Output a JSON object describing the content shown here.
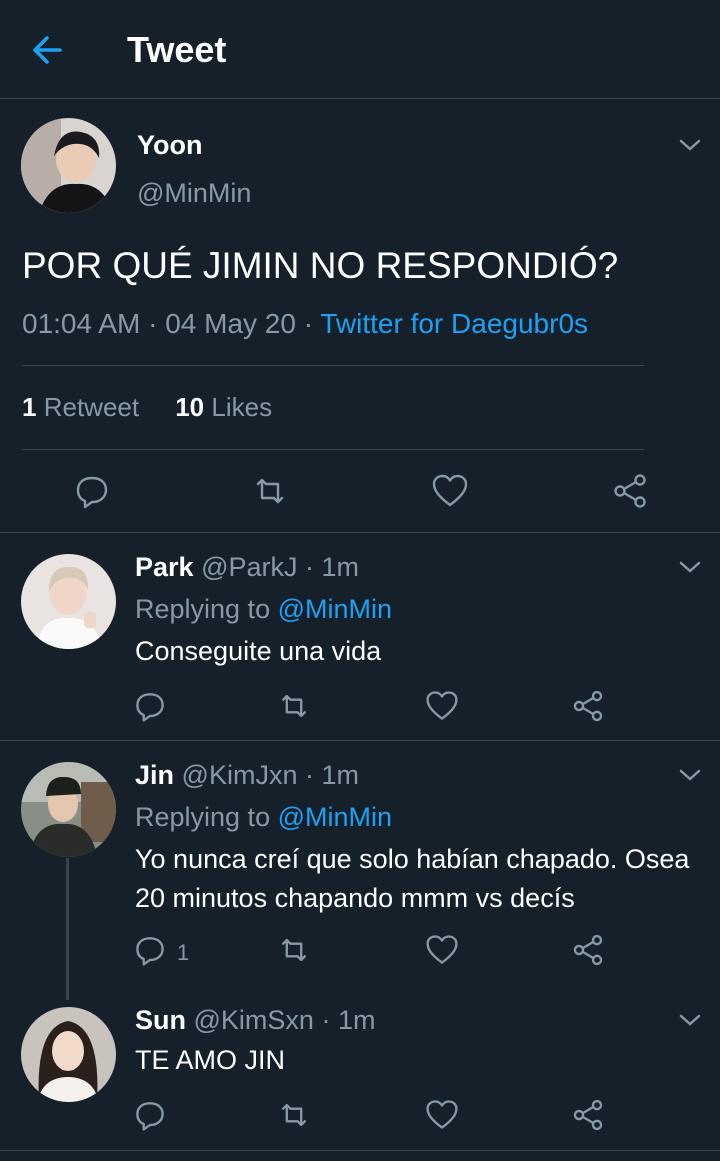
{
  "header": {
    "title": "Tweet"
  },
  "tweet": {
    "name": "Yoon",
    "handle": "@MinMin",
    "text": "POR QUÉ JIMIN NO RESPONDIÓ?",
    "time": "01:04 AM",
    "date": "04 May 20",
    "dot": "·",
    "source": "Twitter for Daegubr0s",
    "retweets": "1",
    "retweets_label": "Retweet",
    "likes": "10",
    "likes_label": "Likes"
  },
  "replies": [
    {
      "name": "Park",
      "handle": "@ParkJ",
      "age": "· 1m",
      "replying_prefix": "Replying to",
      "replying_to": "@MinMin",
      "text": "Conseguite una vida",
      "reply_count": ""
    },
    {
      "name": "Jin",
      "handle": "@KimJxn",
      "age": "· 1m",
      "replying_prefix": "Replying to",
      "replying_to": "@MinMin",
      "text": "Yo nunca creí que solo habían chapado. Osea 20 minutos chapando mmm vs decís",
      "reply_count": "1"
    },
    {
      "name": "Sun",
      "handle": "@KimSxn",
      "age": "· 1m",
      "text": "TE AMO JIN",
      "reply_count": ""
    }
  ],
  "icons": {
    "back": "arrow-left-icon",
    "menu": "chevron-down-icon",
    "reply": "reply-icon",
    "retweet": "retweet-icon",
    "like": "heart-icon",
    "share": "share-icon"
  },
  "colors": {
    "background": "#15202b",
    "accent": "#1da1f2",
    "muted": "#8899a6",
    "border": "#38444d"
  }
}
